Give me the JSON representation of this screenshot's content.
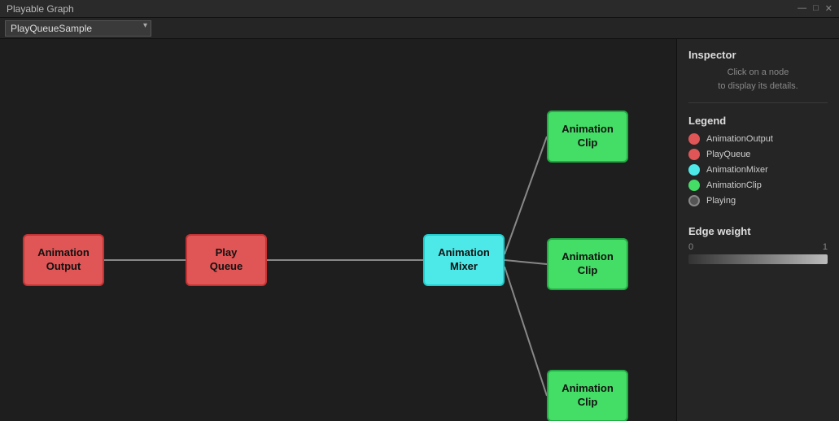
{
  "titlebar": {
    "title": "Playable Graph",
    "controls": [
      "—",
      "□",
      "✕"
    ]
  },
  "toolbar": {
    "dropdown_value": "PlayQueueSample",
    "dropdown_options": [
      "PlayQueueSample"
    ]
  },
  "inspector": {
    "title": "Inspector",
    "hint_line1": "Click on a node",
    "hint_line2": "to display its details."
  },
  "legend": {
    "title": "Legend",
    "items": [
      {
        "label": "AnimationOutput",
        "dot_class": "dot-output"
      },
      {
        "label": "PlayQueue",
        "dot_class": "dot-playqueue"
      },
      {
        "label": "AnimationMixer",
        "dot_class": "dot-mixer"
      },
      {
        "label": "AnimationClip",
        "dot_class": "dot-clip"
      },
      {
        "label": "Playing",
        "dot_class": "dot-playing"
      }
    ]
  },
  "edge_weight": {
    "title": "Edge weight",
    "label_min": "0",
    "label_max": "1"
  },
  "nodes": {
    "animation_output": "Animation\nOutput",
    "play_queue": "Play\nQueue",
    "animation_mixer": "Animation\nMixer",
    "clip_top": "Animation\nClip",
    "clip_mid": "Animation\nClip",
    "clip_bot": "Animation\nClip"
  }
}
